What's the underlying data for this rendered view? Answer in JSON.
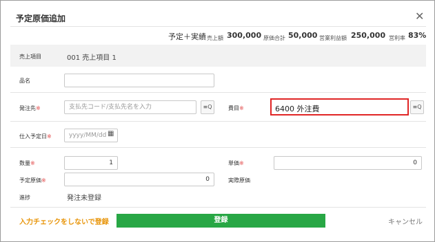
{
  "dialog": {
    "title": "予定原価追加",
    "close_glyph": "✕"
  },
  "summary": {
    "heading": "予定＋実績",
    "sales_label": "売上額",
    "sales_value": "300,000",
    "cost_label": "原価合計",
    "cost_value": "50,000",
    "profit_label": "営業利益額",
    "profit_value": "250,000",
    "rate_label": "営利率",
    "rate_value": "83%"
  },
  "sales_item": {
    "label": "売上項目",
    "value": "001 売上項目 1"
  },
  "form": {
    "product_label": "品名",
    "product_value": "",
    "vendor_label": "発注先",
    "vendor_placeholder": "支払先コード/支払先名を入力",
    "account_label": "費目",
    "account_value": "6400 外注費",
    "date_label": "仕入予定日",
    "date_placeholder": "yyyy/MM/dd",
    "qty_label": "数量",
    "qty_value": "1",
    "unit_price_label": "単価",
    "unit_price_value": "0",
    "planned_cost_label": "予定原価",
    "planned_cost_value": "0",
    "actual_cost_label": "実際原価",
    "progress_label": "進捗",
    "progress_value": "発注未登録",
    "required_mark": "※",
    "search_icon_glyph": "≡Q",
    "calendar_icon_glyph": "▦"
  },
  "footer": {
    "skip_check_label": "入力チェックをしないで登録",
    "register_label": "登録",
    "cancel_label": "キャンセル"
  },
  "colors": {
    "register_bg": "#28a745",
    "required": "#e04040",
    "highlight": "#e02424",
    "skip_link": "#e8950a"
  }
}
